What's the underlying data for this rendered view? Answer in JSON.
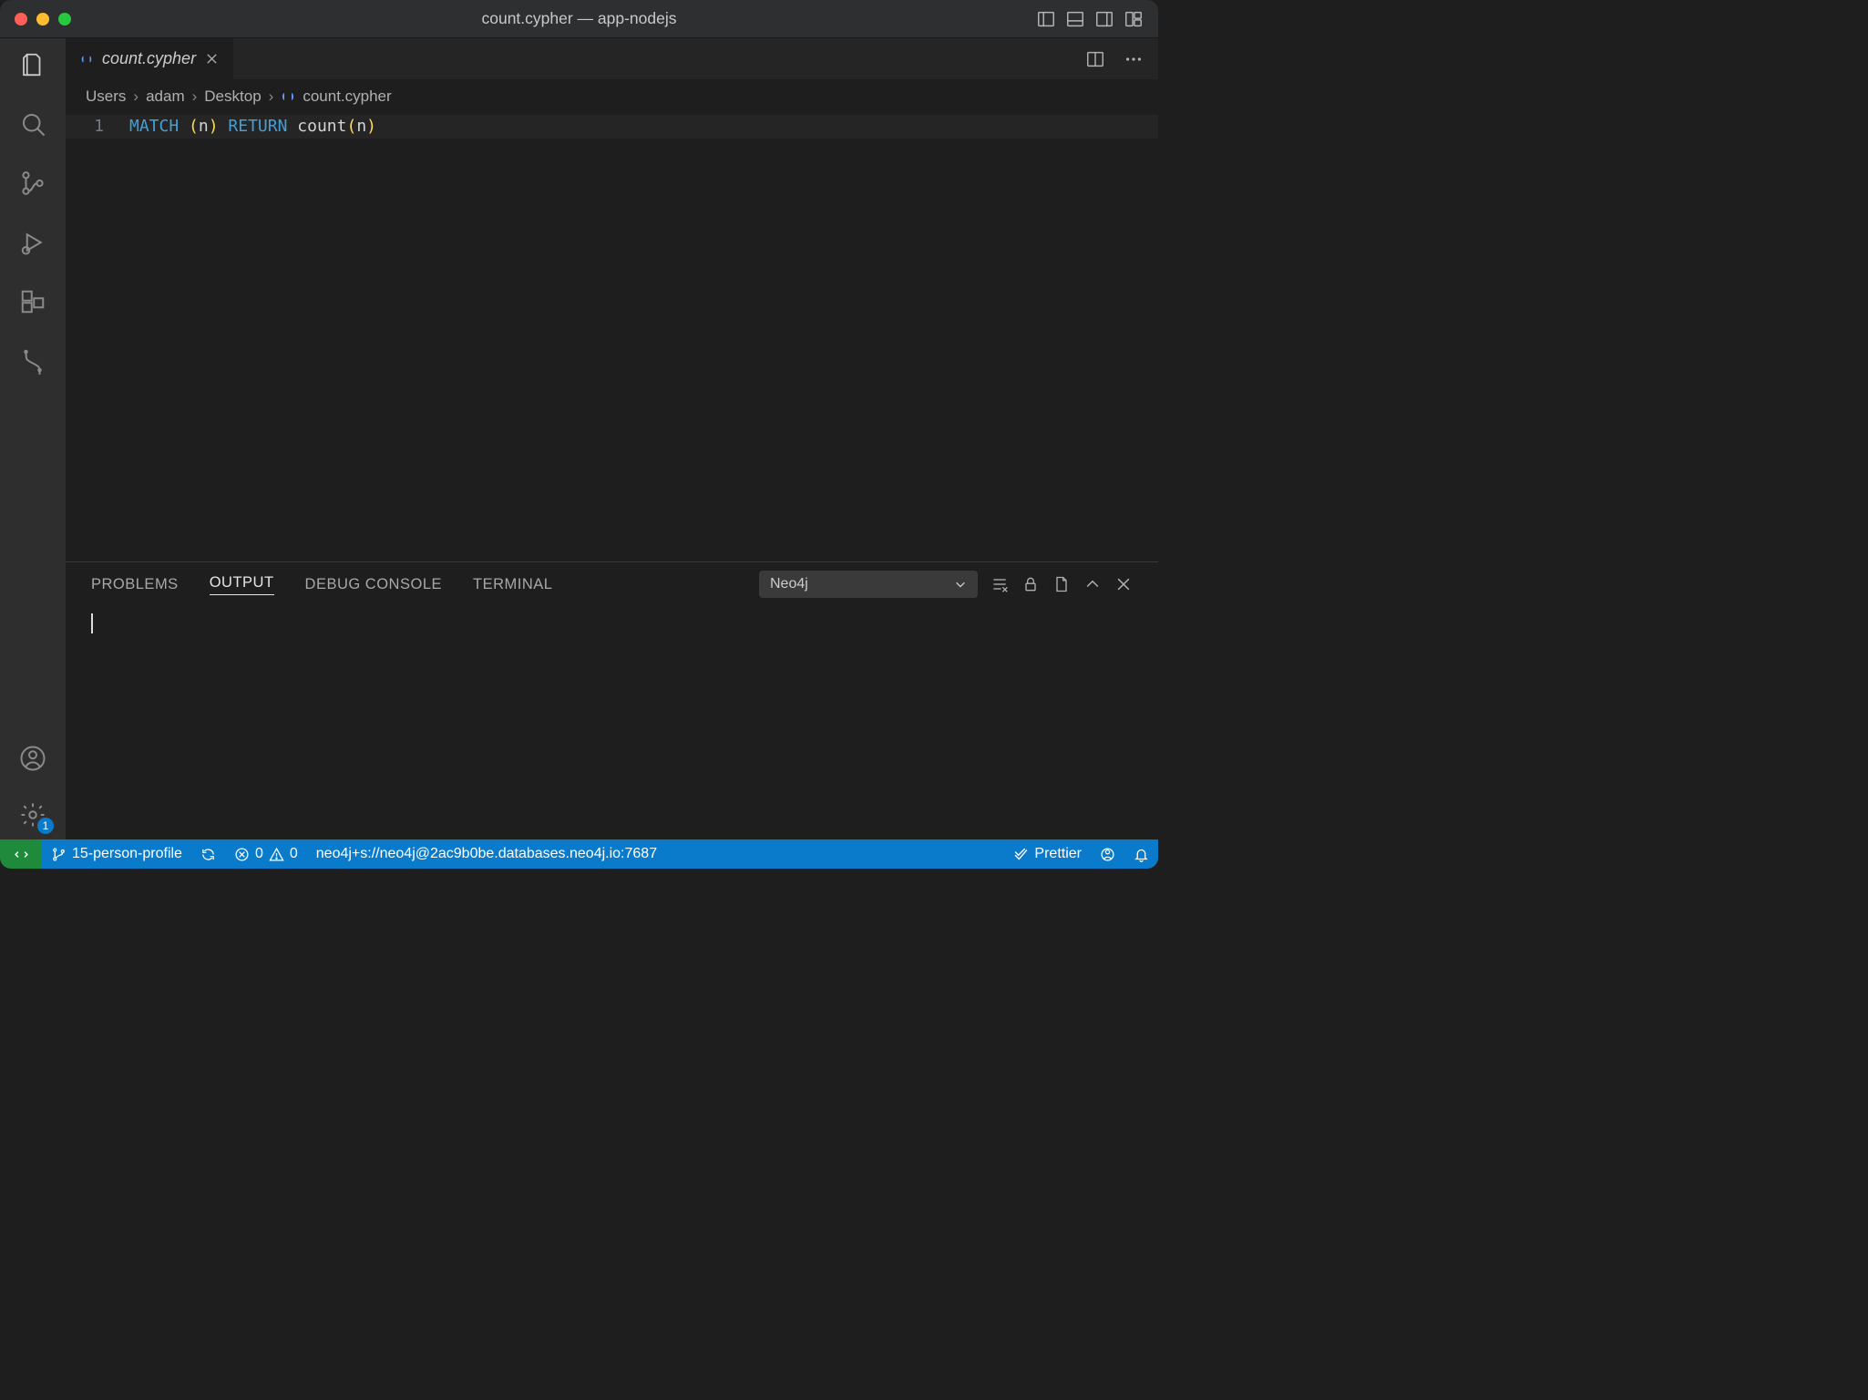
{
  "titlebar": {
    "title": "count.cypher — app-nodejs"
  },
  "tab": {
    "label": "count.cypher"
  },
  "breadcrumbs": {
    "seg0": "Users",
    "seg1": "adam",
    "seg2": "Desktop",
    "file": "count.cypher"
  },
  "editor": {
    "line_number": "1",
    "tok_match": "MATCH",
    "tok_lp1": "(",
    "tok_n1": "n",
    "tok_rp1": ")",
    "tok_return": "RETURN",
    "tok_fn": "count",
    "tok_lp2": "(",
    "tok_n2": "n",
    "tok_rp2": ")"
  },
  "panel": {
    "tab_problems": "PROBLEMS",
    "tab_output": "OUTPUT",
    "tab_debug": "DEBUG CONSOLE",
    "tab_terminal": "TERMINAL",
    "output_channel": "Neo4j",
    "body": ""
  },
  "statusbar": {
    "branch": "15-person-profile",
    "errors": "0",
    "warnings": "0",
    "connection": "neo4j+s://neo4j@2ac9b0be.databases.neo4j.io:7687",
    "prettier": "Prettier",
    "settings_badge": "1"
  }
}
